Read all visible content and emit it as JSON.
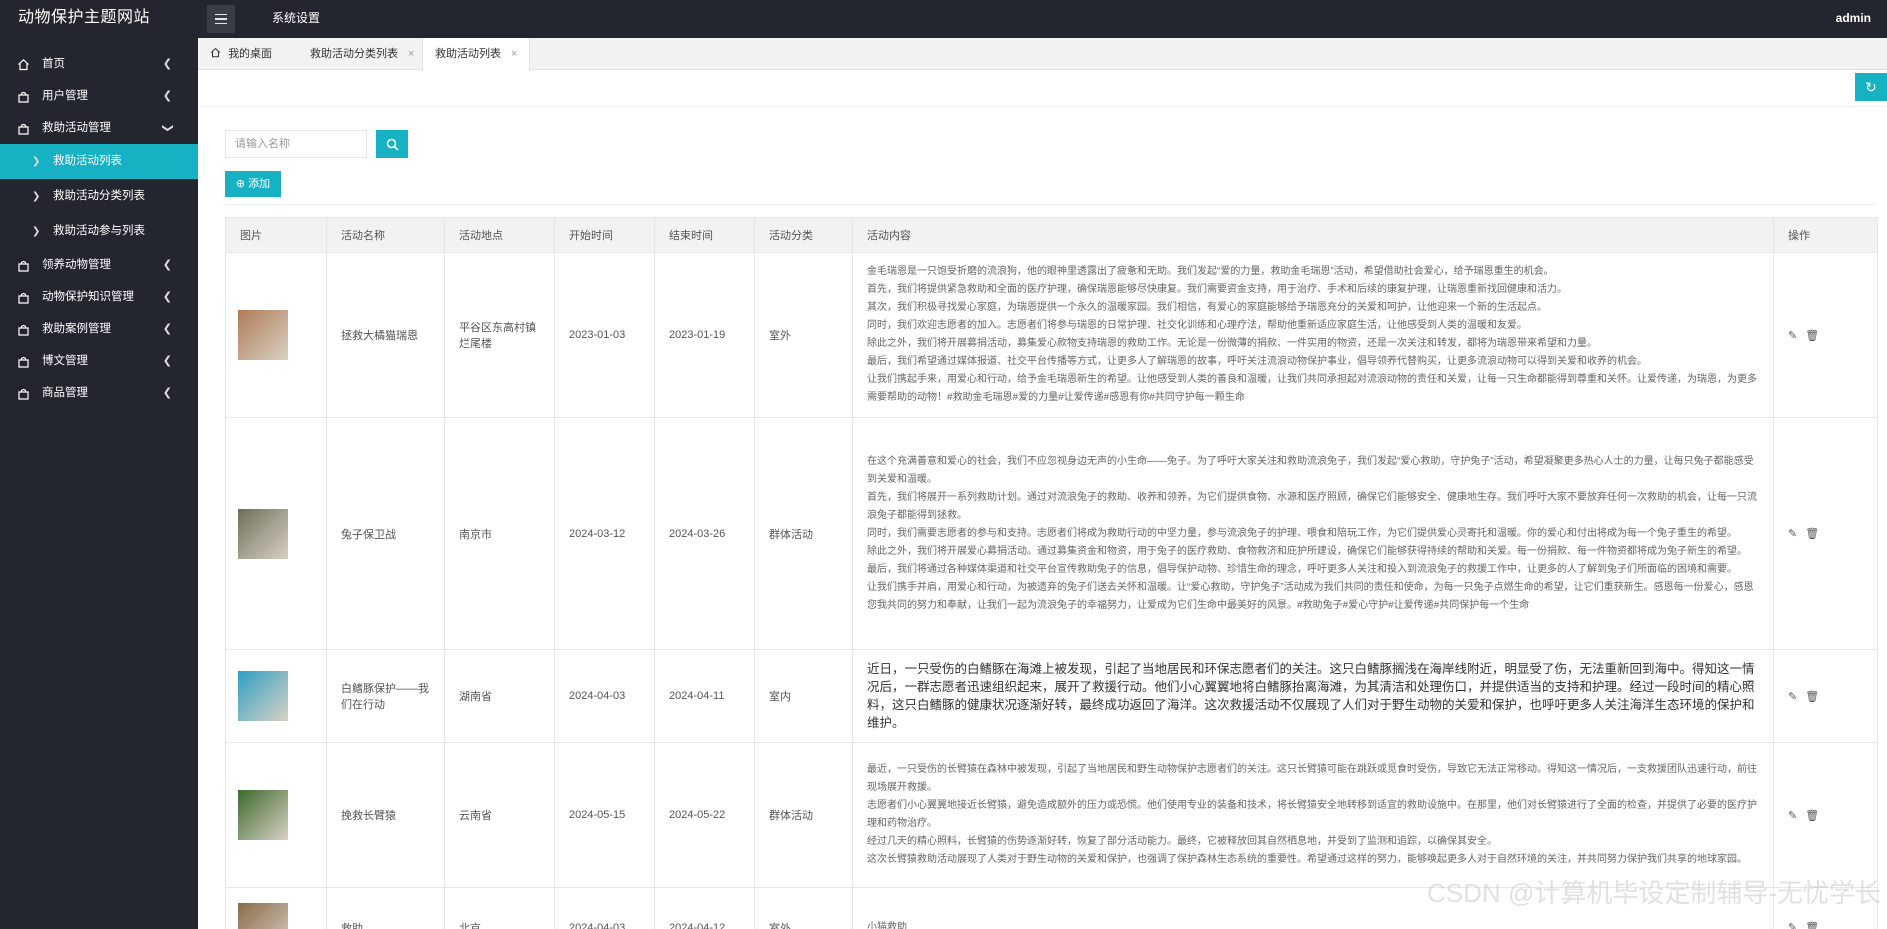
{
  "header": {
    "logo": "动物保护主题网站",
    "system_settings": "系统设置",
    "user": "admin"
  },
  "sidebar": {
    "items": [
      {
        "label": "首页",
        "icon": "home-icon"
      },
      {
        "label": "用户管理",
        "icon": "bag-icon"
      },
      {
        "label": "救助活动管理",
        "icon": "bag-icon"
      },
      {
        "label": "领养动物管理",
        "icon": "bag-icon"
      },
      {
        "label": "动物保护知识管理",
        "icon": "bag-icon"
      },
      {
        "label": "救助案例管理",
        "icon": "bag-icon"
      },
      {
        "label": "博文管理",
        "icon": "bag-icon"
      },
      {
        "label": "商品管理",
        "icon": "bag-icon"
      }
    ],
    "sub_items": [
      {
        "label": "救助活动列表"
      },
      {
        "label": "救助活动分类列表"
      },
      {
        "label": "救助活动参与列表"
      }
    ]
  },
  "tabs": [
    {
      "label": "我的桌面"
    },
    {
      "label": "救助活动分类列表",
      "close": "×"
    },
    {
      "label": "救助活动列表",
      "close": "×"
    }
  ],
  "toolbar": {
    "search_placeholder": "请输入名称",
    "add_label": "添加"
  },
  "table": {
    "headers": [
      "图片",
      "活动名称",
      "活动地点",
      "开始时间",
      "结束时间",
      "活动分类",
      "活动内容",
      "操作"
    ],
    "rows": [
      {
        "name": "拯救大橘猫瑞恩",
        "location": "平谷区东高村镇烂尾楼",
        "start": "2023-01-03",
        "end": "2023-01-19",
        "category": "室外",
        "content": "金毛瑞恩是一只饱受折磨的流浪狗，他的眼神里透露出了疲惫和无助。我们发起“爱的力量，救助金毛瑞恩”活动，希望借助社会爱心，给予瑞恩重生的机会。\n首先，我们将提供紧急救助和全面的医疗护理，确保瑞恩能够尽快康复。我们需要资金支持，用于治疗、手术和后续的康复护理，让瑞恩重新找回健康和活力。\n其次，我们积极寻找爱心家庭，为瑞恩提供一个永久的温暖家园。我们相信，有爱心的家庭能够给予瑞恩充分的关爱和呵护，让他迎来一个新的生活起点。\n同时，我们欢迎志愿者的加入。志愿者们将参与瑞恩的日常护理、社交化训练和心理疗法，帮助他重新适应家庭生活，让他感受到人类的温暖和友爱。\n除此之外，我们将开展募捐活动，募集爱心款物支持瑞恩的救助工作。无论是一份微薄的捐款、一件实用的物资，还是一次关注和转发，都将为瑞恩带来希望和力量。\n最后，我们希望通过媒体报道、社交平台传播等方式，让更多人了解瑞恩的故事，呼吁关注流浪动物保护事业，倡导领养代替购买，让更多流浪动物可以得到关爱和收养的机会。\n让我们携起手来，用爱心和行动，给予金毛瑞恩新生的希望。让他感受到人类的善良和温暖，让我们共同承担起对流浪动物的责任和关爱，让每一只生命都能得到尊重和关怀。让爱传递，为瑞恩，为更多需要帮助的动物！#救助金毛瑞恩#爱的力量#让爱传递#感恩有你#共同守护每一颗生命",
        "ops": [
          "✎",
          "🗑"
        ],
        "img_color": "#b07a58"
      },
      {
        "name": "兔子保卫战",
        "location": "南京市",
        "start": "2024-03-12",
        "end": "2024-03-26",
        "category": "群体活动",
        "content": "在这个充满善意和爱心的社会，我们不应忽视身边无声的小生命——兔子。为了呼吁大家关注和救助流浪兔子，我们发起“爱心救助，守护兔子”活动，希望凝聚更多热心人士的力量，让每只兔子都能感受到关爱和温暖。\n首先，我们将展开一系列救助计划。通过对流浪兔子的救助、收养和领养，为它们提供食物、水源和医疗照顾，确保它们能够安全、健康地生存。我们呼吁大家不要放弃任何一次救助的机会，让每一只流浪兔子都能得到拯救。\n同时，我们需要志愿者的参与和支持。志愿者们将成为救助行动的中坚力量，参与流浪兔子的护理、喂食和陪玩工作，为它们提供爱心灵寄托和温暖。你的爱心和付出将成为每一个兔子重生的希望。\n除此之外，我们将开展爱心募捐活动。通过募集资金和物资，用于兔子的医疗救助、食物救济和庇护所建设，确保它们能够获得持续的帮助和关爱。每一份捐款、每一件物资都将成为兔子新生的希望。\n最后，我们将通过各种媒体渠道和社交平台宣传救助兔子的信息，倡导保护动物、珍惜生命的理念，呼吁更多人关注和投入到流浪兔子的救援工作中，让更多的人了解到兔子们所面临的困境和需要。\n让我们携手并肩，用爱心和行动，为被遗弃的兔子们送去关怀和温暖。让“爱心救助，守护兔子”活动成为我们共同的责任和使命，为每一只兔子点燃生命的希望，让它们重获新生。感恩每一份爱心，感恩您我共同的努力和奉献，让我们一起为流浪兔子的幸福努力，让爱成为它们生命中最美好的风景。#救助兔子#爱心守护#让爱传递#共同保护每一个生命",
        "ops": [
          "✎",
          "🗑"
        ],
        "img_color": "#6d6f5a"
      },
      {
        "name": "白鳍豚保护——我们在行动",
        "location": "湖南省",
        "start": "2024-04-03",
        "end": "2024-04-11",
        "category": "室内",
        "content": "近日，一只受伤的白鳍豚在海滩上被发现，引起了当地居民和环保志愿者们的关注。这只白鳍豚搁浅在海岸线附近，明显受了伤，无法重新回到海中。得知这一情况后，一群志愿者迅速组织起来，展开了救援行动。他们小心翼翼地将白鳍豚抬离海滩，为其清洁和处理伤口，并提供适当的支持和护理。经过一段时间的精心照料，这只白鳍豚的健康状况逐渐好转，最终成功返回了海洋。这次救援活动不仅展现了人们对于野生动物的关爱和保护，也呼吁更多人关注海洋生态环境的保护和维护。",
        "ops": [
          "✎",
          "🗑"
        ],
        "img_color": "#2e9fc4"
      },
      {
        "name": "挽救长臂猿",
        "location": "云南省",
        "start": "2024-05-15",
        "end": "2024-05-22",
        "category": "群体活动",
        "content": "最近，一只受伤的长臂猿在森林中被发现，引起了当地居民和野生动物保护志愿者们的关注。这只长臂猿可能在跳跃或觅食时受伤，导致它无法正常移动。得知这一情况后，一支救援团队迅速行动，前往现场展开救援。\n志愿者们小心翼翼地接近长臂猿，避免造成额外的压力或恐慌。他们使用专业的装备和技术，将长臂猿安全地转移到适宜的救助设施中。在那里，他们对长臂猿进行了全面的检查，并提供了必要的医疗护理和药物治疗。\n经过几天的精心照料，长臂猿的伤势逐渐好转，恢复了部分活动能力。最终，它被释放回其自然栖息地，并受到了监测和追踪，以确保其安全。\n这次长臂猿救助活动展现了人类对于野生动物的关爱和保护，也强调了保护森林生态系统的重要性。希望通过这样的努力，能够唤起更多人对于自然环境的关注，并共同努力保护我们共享的地球家园。",
        "ops": [
          "✎",
          "🗑"
        ],
        "img_color": "#3c6a2e"
      },
      {
        "name": "救助",
        "location": "北京",
        "start": "2024-04-03",
        "end": "2024-04-12",
        "category": "室外",
        "content": "小猫救助",
        "ops": [
          "✎",
          "🗑"
        ],
        "img_color": "#8a6a4a"
      }
    ]
  },
  "watermark": "CSDN @计算机毕设定制辅导-无忧学长"
}
